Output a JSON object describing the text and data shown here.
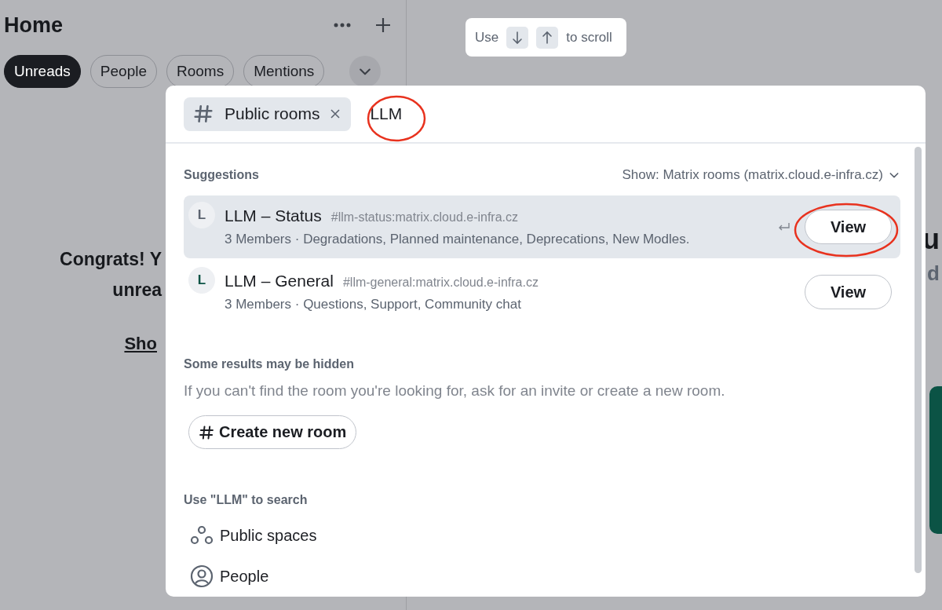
{
  "sidebar": {
    "title": "Home",
    "filters": [
      {
        "label": "Unreads",
        "selected": true
      },
      {
        "label": "People",
        "selected": false
      },
      {
        "label": "Rooms",
        "selected": false
      },
      {
        "label": "Mentions",
        "selected": false
      }
    ],
    "empty_state": {
      "heading_lines": [
        "Congrats! Y",
        "unrea"
      ],
      "link": "Sho"
    }
  },
  "main": {
    "fragments": [
      "u",
      "d"
    ]
  },
  "scroll_hint": {
    "prefix": "Use",
    "suffix": "to scroll"
  },
  "dialog": {
    "filter_chip": "Public rooms",
    "search_value": "LLM",
    "suggestions_heading": "Suggestions",
    "show_filter": "Show: Matrix rooms (matrix.cloud.e-infra.cz)",
    "results": [
      {
        "avatar": "L",
        "color": "#5c6470",
        "name": "LLM – Status",
        "alias": "#llm-status:matrix.cloud.e-infra.cz",
        "description": "3 Members · Degradations, Planned maintenance, Deprecations, New Modles.",
        "button": "View",
        "selected": true
      },
      {
        "avatar": "L",
        "color": "#0b5345",
        "name": "LLM – General",
        "alias": "#llm-general:matrix.cloud.e-infra.cz",
        "description": "3 Members · Questions, Support, Community chat",
        "button": "View",
        "selected": false
      }
    ],
    "hidden_heading": "Some results may be hidden",
    "hidden_text": "If you can't find the room you're looking for, ask for an invite or create a new room.",
    "create_button": "Create new room",
    "search_heading": "Use \"LLM\" to search",
    "search_options": [
      {
        "kind": "spaces",
        "label": "Public spaces"
      },
      {
        "kind": "people",
        "label": "People"
      }
    ]
  }
}
